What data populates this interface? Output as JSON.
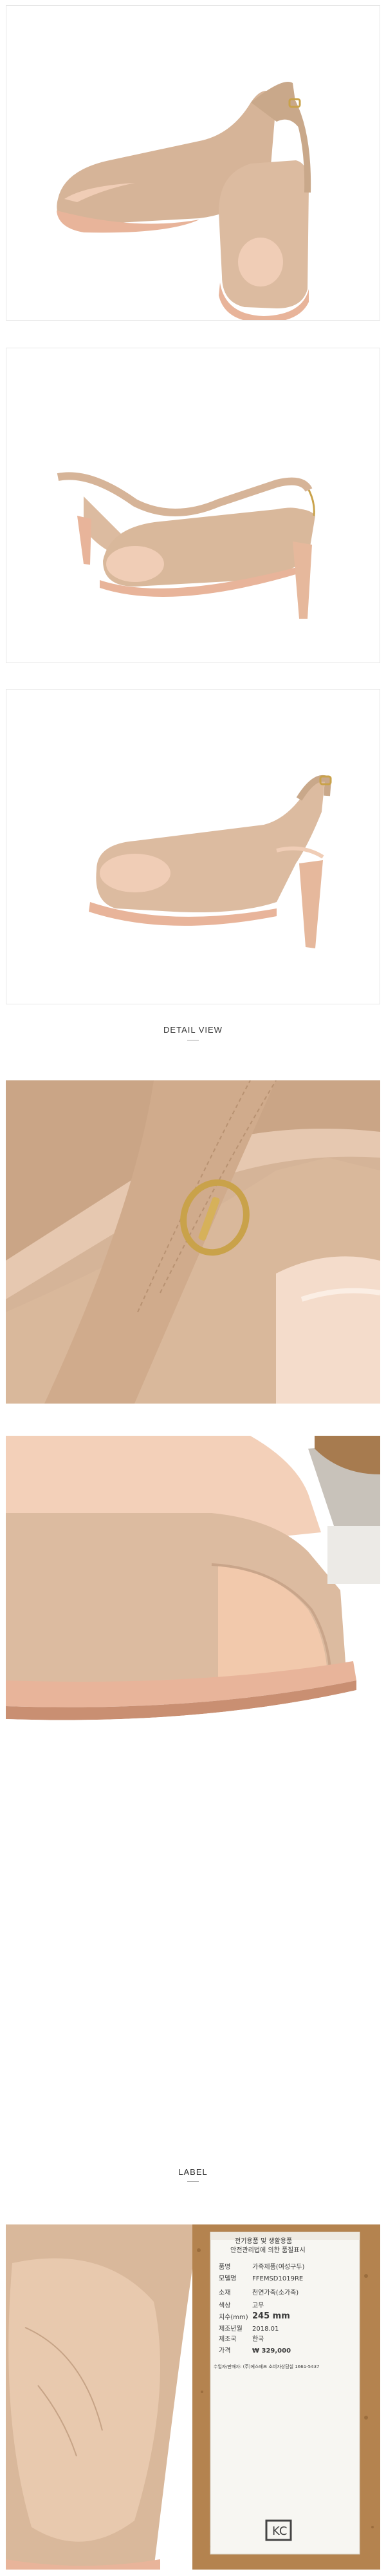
{
  "sections": {
    "detail_view": "DETAIL VIEW",
    "label": "LABEL"
  },
  "label_tag": {
    "header_1": "전기용품 및 생활용품",
    "header_2": "안전관리법에 의한 품질표시",
    "rows": [
      {
        "key": "품명",
        "value": "가죽제품(여성구두)"
      },
      {
        "key": "모델명",
        "value": "FFEMSD1019RE"
      },
      {
        "key": "소재",
        "value": "천연가죽(소가죽)"
      },
      {
        "key": "색상",
        "value": "고무"
      },
      {
        "key": "치수(mm)",
        "value": "245 mm"
      },
      {
        "key": "제조년월",
        "value": "2018.01"
      },
      {
        "key": "제조국",
        "value": "한국"
      },
      {
        "key": "가격",
        "value": "₩ 329,000"
      }
    ],
    "footer": "수입자/판매자: (주)에스에프 소비자상담실 1661-5437"
  },
  "colors": {
    "leather": "#d9b89b",
    "leather_shadow": "#b89272",
    "rose_gold": "#e8b49a",
    "lining": "#f0cdb6",
    "buckle": "#c9a24a",
    "cork": "#b4834f"
  }
}
